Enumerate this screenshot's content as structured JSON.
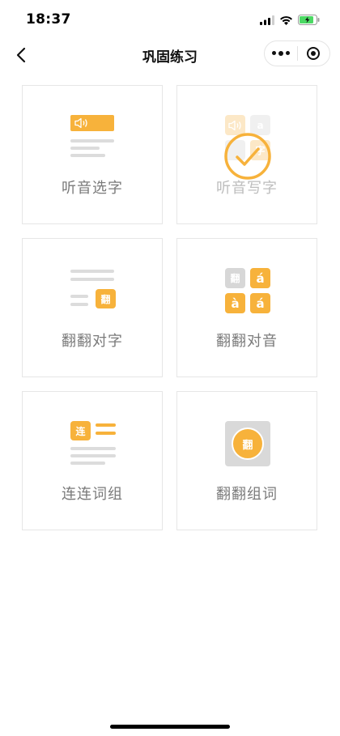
{
  "status_bar": {
    "time": "18:37",
    "battery_charging": true
  },
  "nav": {
    "title": "巩固练习"
  },
  "colors": {
    "accent": "#f7b23b",
    "accent_light": "#fbd79a",
    "muted": "#dcdcdc",
    "label": "#7a7a7a"
  },
  "cards": [
    {
      "label": "听音选字",
      "icon": "speaker-choice-icon",
      "state": "available"
    },
    {
      "label": "听音写字",
      "icon": "speaker-write-icon",
      "state": "completed"
    },
    {
      "label": "翻翻对字",
      "icon": "flip-match-char-icon",
      "state": "available",
      "tile_text": "翻"
    },
    {
      "label": "翻翻对音",
      "icon": "flip-match-sound-icon",
      "state": "available",
      "tiles": [
        "翻",
        "á",
        "à",
        "á"
      ]
    },
    {
      "label": "连连词组",
      "icon": "link-words-icon",
      "state": "available",
      "tile_text": "连"
    },
    {
      "label": "翻翻组词",
      "icon": "flip-compose-icon",
      "state": "available",
      "tile_text": "翻"
    }
  ],
  "card2_tiles": [
    "a",
    "字"
  ]
}
